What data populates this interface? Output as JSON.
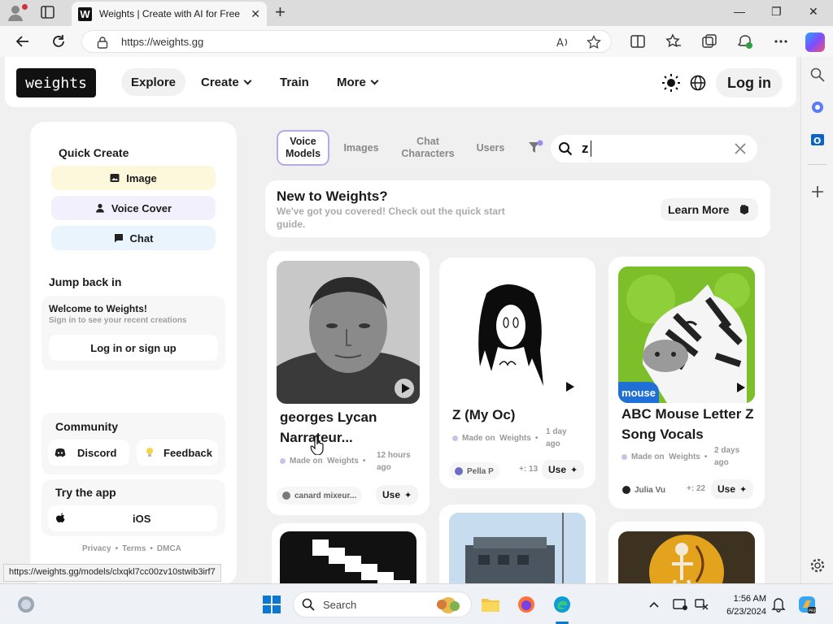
{
  "browser": {
    "tab_title": "Weights | Create with AI for Free",
    "favicon": "W",
    "url": "https://weights.gg",
    "status_url": "https://weights.gg/models/clxqkl7cc00zv10stwib3irf7"
  },
  "header": {
    "logo": "weights",
    "nav": [
      "Explore",
      "Create",
      "Train",
      "More"
    ],
    "login": "Log in"
  },
  "sidebar": {
    "quick_create_title": "Quick Create",
    "quick_create": [
      {
        "label": "Image",
        "color": "#fdf7dc"
      },
      {
        "label": "Voice Cover",
        "color": "#f2f0fc"
      },
      {
        "label": "Chat",
        "color": "#eaf4fc"
      }
    ],
    "jump_back_title": "Jump back in",
    "welcome_title": "Welcome to Weights!",
    "welcome_sub": "Sign in to see your recent creations",
    "signin_button": "Log in or sign up",
    "community_title": "Community",
    "discord": "Discord",
    "feedback": "Feedback",
    "try_app_title": "Try the app",
    "ios": "iOS",
    "footer": [
      "Privacy",
      "Terms",
      "DMCA"
    ]
  },
  "filters": {
    "tabs": [
      "Voice Models",
      "Images",
      "Chat Characters",
      "Users"
    ],
    "active": "Voice Models",
    "search_value": "z"
  },
  "promo": {
    "title": "New to Weights?",
    "subtitle": "We've got you covered! Check out the quick start guide.",
    "button": "Learn More"
  },
  "models": [
    {
      "title_line1": "georges Lycan",
      "title_line2": "Narrateur...",
      "made_on": "Made on",
      "platform": "Weights",
      "time_line1": "12 hours",
      "time_line2": "ago",
      "author": "canard mixeur...",
      "count": "",
      "use": "Use"
    },
    {
      "title_line1": "Z (My Oc)",
      "title_line2": "",
      "made_on": "Made on",
      "platform": "Weights",
      "time_line1": "1 day",
      "time_line2": "ago",
      "author": "Pella P",
      "count": "13",
      "use": "Use"
    },
    {
      "title_line1": "ABC Mouse Letter Z",
      "title_line2": "Song Vocals",
      "made_on": "Made on",
      "platform": "Weights",
      "time_line1": "2 days",
      "time_line2": "ago",
      "author": "Julia Vu",
      "count": "22",
      "use": "Use"
    }
  ],
  "thumb_badges": {
    "abc_mouse": "mouse"
  },
  "taskbar": {
    "search_placeholder": "Search",
    "time": "1:56 AM",
    "date": "6/23/2024"
  },
  "colors": {
    "accent": "#b7a9e6",
    "zebra_bg": "#7cbf2a",
    "mouse_blue": "#1f6fd6"
  }
}
